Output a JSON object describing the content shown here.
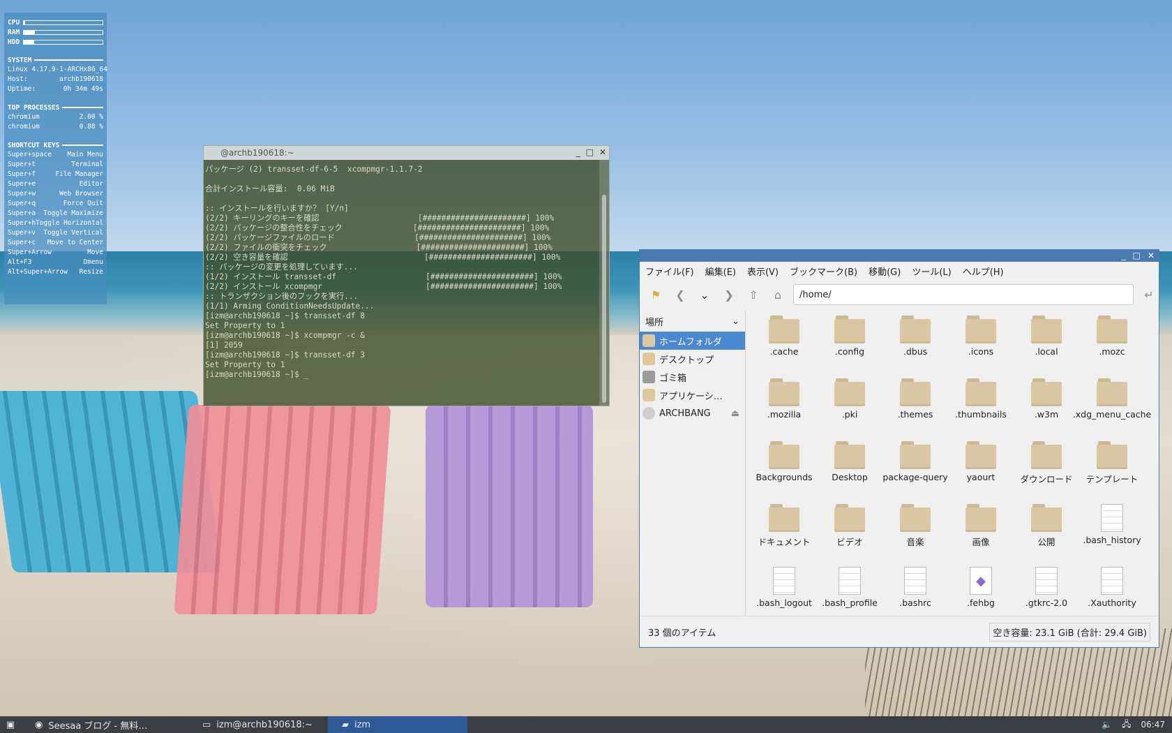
{
  "conky": {
    "bars": [
      {
        "label": "CPU",
        "fill": 0.02
      },
      {
        "label": "RAM",
        "fill": 0.14
      },
      {
        "label": "HDD",
        "fill": 0.13
      }
    ],
    "system": {
      "heading": "SYSTEM",
      "rows": [
        {
          "left": "Linux 4.17.9-1-ARCH",
          "right": "x86_64"
        },
        {
          "left": "Host:",
          "right": "archb190618"
        },
        {
          "left": "Uptime:",
          "right": "0h 34m 49s"
        }
      ]
    },
    "processes": {
      "heading": "TOP PROCESSES",
      "rows": [
        {
          "left": "chromium",
          "right": "2.00 %"
        },
        {
          "left": "chromium",
          "right": "0.88 %"
        }
      ]
    },
    "shortcuts": {
      "heading": "SHORTCUT KEYS",
      "rows": [
        {
          "left": "Super+space",
          "right": "Main Menu"
        },
        {
          "left": "Super+t",
          "right": "Terminal"
        },
        {
          "left": "Super+f",
          "right": "File Manager"
        },
        {
          "left": "Super+e",
          "right": "Editor"
        },
        {
          "left": "Super+w",
          "right": "Web Browser"
        },
        {
          "left": "Super+q",
          "right": "Force Quit"
        },
        {
          "left": "Super+a",
          "right": "Toggle Maximize"
        },
        {
          "left": "Super+h",
          "right": "Toggle Horizontal"
        },
        {
          "left": "Super+v",
          "right": "Toggle Vertical"
        },
        {
          "left": "Super+c",
          "right": "Move to Center"
        },
        {
          "left": "Super+Arrow",
          "right": "Move"
        },
        {
          "left": "Alt+F3",
          "right": "Dmenu"
        },
        {
          "left": "Alt+Super+Arrow",
          "right": "Resize"
        }
      ]
    }
  },
  "terminal": {
    "title": "@archb190618:~",
    "lines": [
      "パッケージ (2) transset-df-6-5  xcompmgr-1.1.7-2",
      "",
      "合計インストール容量:  0.06 MiB",
      "",
      ":: インストールを行いますか？ [Y/n]",
      "(2/2) キーリングのキーを確認                     [######################] 100%",
      "(2/2) パッケージの整合性をチェック               [######################] 100%",
      "(2/2) パッケージファイルのロード                 [######################] 100%",
      "(2/2) ファイルの衝突をチェック                   [######################] 100%",
      "(2/2) 空き容量を確認                             [######################] 100%",
      ":: パッケージの変更を処理しています...",
      "(1/2) インストール transset-df                   [######################] 100%",
      "(2/2) インストール xcompmgr                      [######################] 100%",
      ":: トランザクション後のフックを実行...",
      "(1/1) Arming ConditionNeedsUpdate...",
      "[izm@archb190618 ~]$ transset-df 8",
      "Set Property to 1",
      "[izm@archb190618 ~]$ xcompmgr -c &",
      "[1] 2059",
      "[izm@archb190618 ~]$ transset-df 3",
      "Set Property to 1",
      "[izm@archb190618 ~]$ _"
    ]
  },
  "filemanager": {
    "menu": [
      "ファイル(F)",
      "編集(E)",
      "表示(V)",
      "ブックマーク(B)",
      "移動(G)",
      "ツール(L)",
      "ヘルプ(H)"
    ],
    "path": "/home/",
    "places_label": "場所",
    "places": [
      {
        "label": "ホームフォルダ",
        "selected": true
      },
      {
        "label": "デスクトップ",
        "selected": false
      },
      {
        "label": "ゴミ箱",
        "selected": false
      },
      {
        "label": "アプリケーシ…",
        "selected": false
      },
      {
        "label": "ARCHBANG",
        "selected": false
      }
    ],
    "items": [
      {
        "name": ".cache",
        "kind": "folder"
      },
      {
        "name": ".config",
        "kind": "folder"
      },
      {
        "name": ".dbus",
        "kind": "folder"
      },
      {
        "name": ".icons",
        "kind": "folder"
      },
      {
        "name": ".local",
        "kind": "folder"
      },
      {
        "name": ".mozc",
        "kind": "folder"
      },
      {
        "name": ".mozilla",
        "kind": "folder"
      },
      {
        "name": ".pki",
        "kind": "folder"
      },
      {
        "name": ".themes",
        "kind": "folder"
      },
      {
        "name": ".thumbnails",
        "kind": "folder"
      },
      {
        "name": ".w3m",
        "kind": "folder"
      },
      {
        "name": ".xdg_menu_cache",
        "kind": "folder"
      },
      {
        "name": "Backgrounds",
        "kind": "folder"
      },
      {
        "name": "Desktop",
        "kind": "folder"
      },
      {
        "name": "package-query",
        "kind": "folder"
      },
      {
        "name": "yaourt",
        "kind": "folder"
      },
      {
        "name": "ダウンロード",
        "kind": "folder"
      },
      {
        "name": "テンプレート",
        "kind": "folder"
      },
      {
        "name": "ドキュメント",
        "kind": "folder"
      },
      {
        "name": "ビデオ",
        "kind": "folder"
      },
      {
        "name": "音楽",
        "kind": "folder"
      },
      {
        "name": "画像",
        "kind": "folder"
      },
      {
        "name": "公開",
        "kind": "folder"
      },
      {
        "name": ".bash_history",
        "kind": "file"
      },
      {
        "name": ".bash_logout",
        "kind": "file"
      },
      {
        "name": ".bash_profile",
        "kind": "file"
      },
      {
        "name": ".bashrc",
        "kind": "file"
      },
      {
        "name": ".fehbg",
        "kind": "script"
      },
      {
        "name": ".gtkrc-2.0",
        "kind": "file"
      },
      {
        "name": ".Xauthority",
        "kind": "file"
      },
      {
        "name": "",
        "kind": "script"
      },
      {
        "name": "",
        "kind": "file"
      },
      {
        "name": "",
        "kind": "file"
      }
    ],
    "status_count": "33 個のアイテム",
    "status_free": "空き容量: 23.1 GiB (合計: 29.4 GiB)"
  },
  "taskbar": {
    "tasks": [
      {
        "label": "Seesaa ブログ - 無料…",
        "active": false
      },
      {
        "label": "izm@archb190618:~",
        "active": false
      },
      {
        "label": "izm",
        "active": true
      }
    ],
    "clock": "06:47"
  }
}
